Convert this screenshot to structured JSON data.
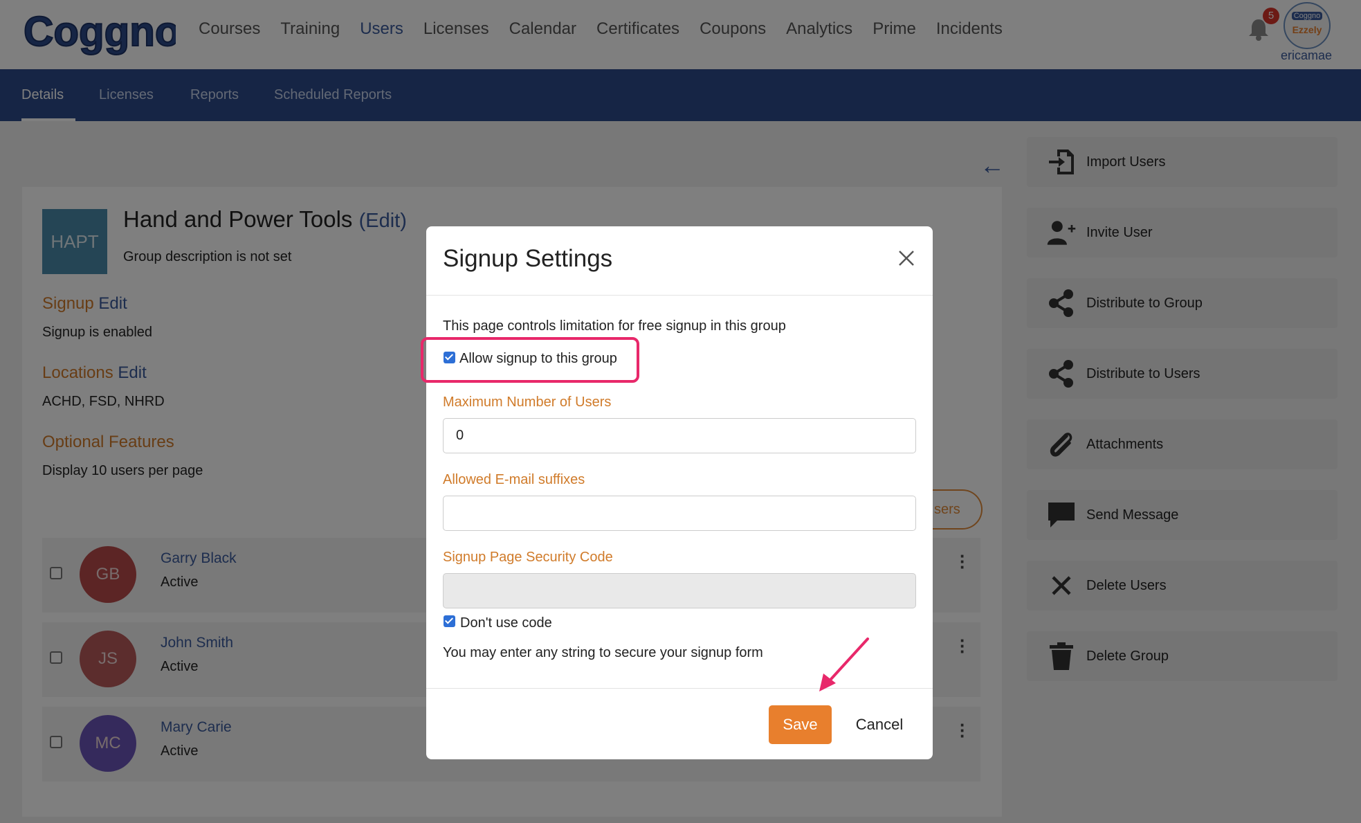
{
  "header": {
    "logo_text": "Coggno",
    "nav": [
      "Courses",
      "Training",
      "Users",
      "Licenses",
      "Calendar",
      "Certificates",
      "Coupons",
      "Analytics",
      "Prime",
      "Incidents"
    ],
    "active_nav": "Users",
    "notification_count": "5",
    "avatar_text_top": "Coggno",
    "avatar_text_bottom": "Ezzely",
    "username": "ericamae"
  },
  "subnav": {
    "tabs": [
      "Details",
      "Licenses",
      "Reports",
      "Scheduled Reports"
    ],
    "active": "Details"
  },
  "group": {
    "logo_text": "HAPT",
    "title": "Hand and Power Tools",
    "edit_label": "(Edit)",
    "description": "Group description is not set",
    "signup_heading": "Signup",
    "signup_edit": "Edit",
    "signup_value": "Signup is enabled",
    "locations_heading": "Locations",
    "locations_edit": "Edit",
    "locations_value": "ACHD, FSD, NHRD",
    "optional_heading": "Optional Features",
    "optional_value": "Display 10 users per page",
    "pill_partial": "sers"
  },
  "users": [
    {
      "initials": "GB",
      "name": "Garry Black",
      "status": "Active",
      "color": "#b84a4a"
    },
    {
      "initials": "JS",
      "name": "John Smith",
      "status": "Active",
      "color": "#b85a5a"
    },
    {
      "initials": "MC",
      "name": "Mary Carie",
      "status": "Active",
      "color": "#6a55b8"
    }
  ],
  "sidebar": {
    "buttons": [
      {
        "label": "Import Users",
        "icon": "import-icon"
      },
      {
        "label": "Invite User",
        "icon": "user-plus-icon"
      },
      {
        "label": "Distribute to Group",
        "icon": "share-icon"
      },
      {
        "label": "Distribute to Users",
        "icon": "share-icon"
      },
      {
        "label": "Attachments",
        "icon": "paperclip-icon"
      },
      {
        "label": "Send Message",
        "icon": "message-icon"
      },
      {
        "label": "Delete Users",
        "icon": "x-icon"
      },
      {
        "label": "Delete Group",
        "icon": "trash-icon"
      }
    ]
  },
  "modal": {
    "title": "Signup Settings",
    "intro": "This page controls limitation for free signup in this group",
    "allow_signup_label": "Allow signup to this group",
    "max_users_label": "Maximum Number of Users",
    "max_users_value": "0",
    "email_suffix_label": "Allowed E-mail suffixes",
    "email_suffix_value": "",
    "security_code_label": "Signup Page Security Code",
    "security_code_value": "",
    "dont_use_code_label": "Don't use code",
    "hint": "You may enter any string to secure your signup form",
    "save_label": "Save",
    "cancel_label": "Cancel"
  },
  "colors": {
    "accent": "#e87f2d",
    "brand": "#2c4a8a",
    "highlight": "#e8286a"
  }
}
